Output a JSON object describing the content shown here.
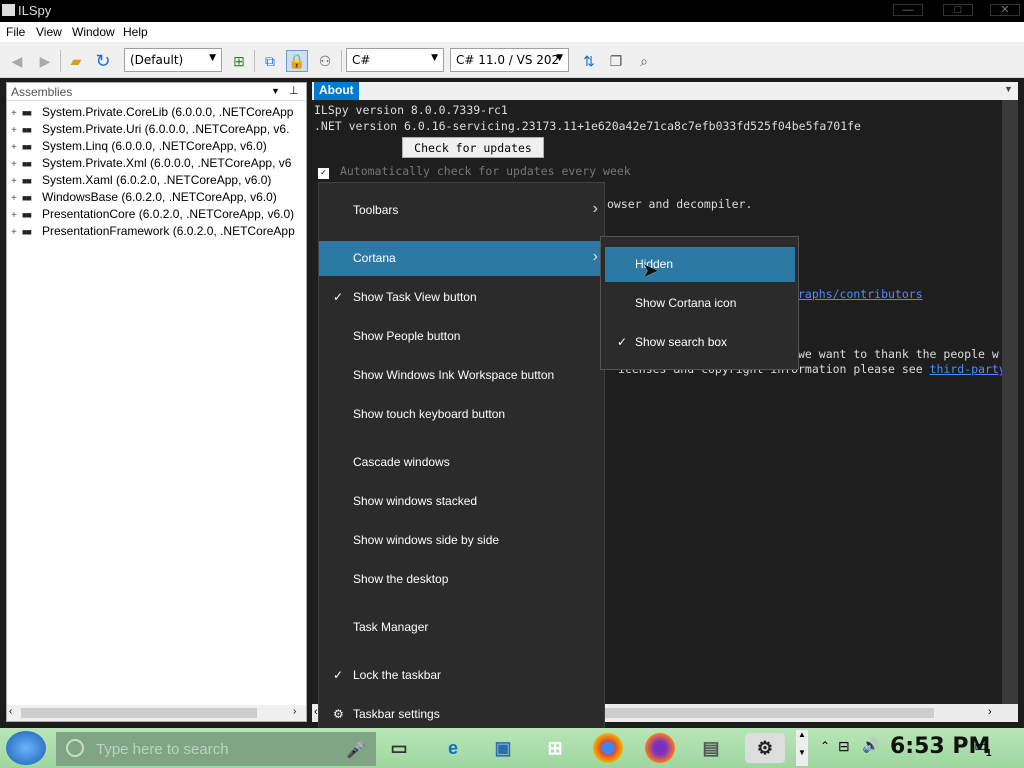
{
  "window": {
    "title": "ILSpy",
    "controls": [
      "—",
      "□",
      "✕"
    ]
  },
  "menubar": {
    "items": [
      "File",
      "View",
      "Window",
      "Help"
    ]
  },
  "toolbar": {
    "assembly_list": "(Default)",
    "language": "C#",
    "language_version": "C# 11.0 / VS 202"
  },
  "assemblies": {
    "header": "Assemblies",
    "items": [
      "System.Private.CoreLib (6.0.0.0, .NETCoreApp",
      "System.Private.Uri (6.0.0.0, .NETCoreApp, v6.",
      "System.Linq (6.0.0.0, .NETCoreApp, v6.0)",
      "System.Private.Xml (6.0.0.0, .NETCoreApp, v6",
      "System.Xaml (6.0.2.0, .NETCoreApp, v6.0)",
      "WindowsBase (6.0.2.0, .NETCoreApp, v6.0)",
      "PresentationCore (6.0.2.0, .NETCoreApp, v6.0)",
      "PresentationFramework (6.0.2.0, .NETCoreApp"
    ]
  },
  "about": {
    "tab": "About",
    "line1": "ILSpy version 8.0.0.7339-rc1",
    "line2": ".NET version 6.0.16-servicing.23173.11+1e620a42e71ca8c7efb033fd525f04be5fa701fe",
    "check_button": "Check for updates",
    "auto_check": "Automatically check for updates every week",
    "fragment_browser": "owser and decompiler.",
    "fragment_contrib": "raphs/contributors",
    "fragment_thanks": "we want to thank the people w",
    "fragment_license": "icenses and copyright information please see ",
    "fragment_thirdparty": "third-party"
  },
  "context_menu": {
    "items": [
      {
        "label": "Toolbars",
        "submenu": true
      },
      {
        "label": "Cortana",
        "submenu": true,
        "active": true
      },
      {
        "label": "Show Task View button",
        "checked": true
      },
      {
        "label": "Show People button"
      },
      {
        "label": "Show Windows Ink Workspace button"
      },
      {
        "label": "Show touch keyboard button"
      },
      {
        "label": "Cascade windows"
      },
      {
        "label": "Show windows stacked"
      },
      {
        "label": "Show windows side by side"
      },
      {
        "label": "Show the desktop"
      },
      {
        "label": "Task Manager"
      },
      {
        "label": "Lock the taskbar",
        "checked": true
      },
      {
        "label": "Taskbar settings",
        "icon": "gear-icon"
      }
    ]
  },
  "cortana_submenu": {
    "items": [
      {
        "label": "Hidden",
        "active": true
      },
      {
        "label": "Show Cortana icon"
      },
      {
        "label": "Show search box",
        "checked": true
      }
    ]
  },
  "taskbar": {
    "search_placeholder": "Type here to search",
    "clock": "6:53 PM",
    "notification_count": "1"
  }
}
